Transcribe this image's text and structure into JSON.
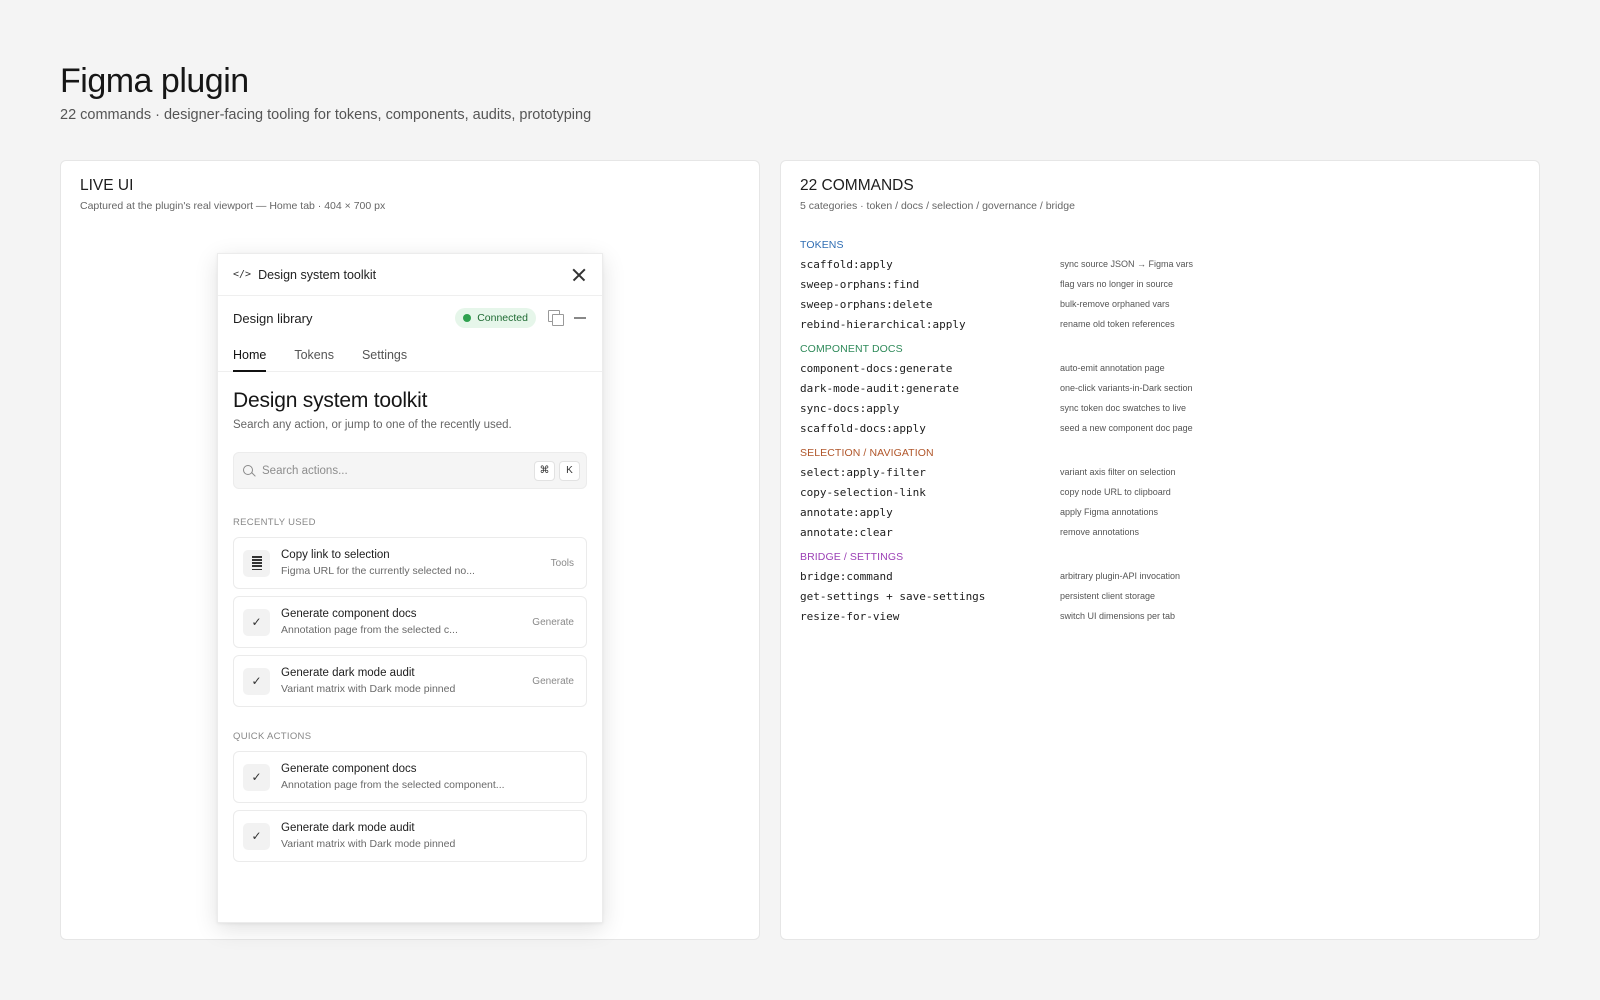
{
  "page": {
    "title": "Figma plugin",
    "subtitle": "22 commands · designer-facing tooling for tokens, components, audits, prototyping"
  },
  "live_ui": {
    "title": "LIVE UI",
    "subtitle": "Captured at the plugin's real viewport — Home tab · 404 × 700 px"
  },
  "plugin": {
    "code_icon": "</>",
    "name": "Design system toolkit",
    "library": "Design library",
    "status": "Connected",
    "tabs": [
      {
        "label": "Home",
        "active": true
      },
      {
        "label": "Tokens",
        "active": false
      },
      {
        "label": "Settings",
        "active": false
      }
    ],
    "hero_title": "Design system toolkit",
    "hero_subtitle": "Search any action, or jump to one of the recently used.",
    "search": {
      "placeholder": "Search actions...",
      "kbd_1": "⌘",
      "kbd_2": "K"
    },
    "recent_label": "RECENTLY USED",
    "recent": [
      {
        "icon": "document-icon",
        "title": "Copy link to selection",
        "desc": "Figma URL for the currently selected no...",
        "tag": "Tools"
      },
      {
        "icon": "check-icon",
        "title": "Generate component docs",
        "desc": "Annotation page from the selected c...",
        "tag": "Generate"
      },
      {
        "icon": "check-icon",
        "title": "Generate dark mode audit",
        "desc": "Variant matrix with Dark mode pinned",
        "tag": "Generate"
      }
    ],
    "quick_label": "QUICK ACTIONS",
    "quick": [
      {
        "icon": "check-icon",
        "title": "Generate component docs",
        "desc": "Annotation page from the selected component..."
      },
      {
        "icon": "check-icon",
        "title": "Generate dark mode audit",
        "desc": "Variant matrix with Dark mode pinned"
      }
    ],
    "check_glyph": "✓"
  },
  "commands": {
    "title": "22 COMMANDS",
    "subtitle": "5 categories · token / docs / selection / governance / bridge",
    "categories": [
      {
        "label": "TOKENS",
        "color": "#2f6db3",
        "items": [
          {
            "name": "scaffold:apply",
            "desc": "sync source JSON → Figma vars"
          },
          {
            "name": "sweep-orphans:find",
            "desc": "flag vars no longer in source"
          },
          {
            "name": "sweep-orphans:delete",
            "desc": "bulk-remove orphaned vars"
          },
          {
            "name": "rebind-hierarchical:apply",
            "desc": "rename old token references"
          }
        ]
      },
      {
        "label": "COMPONENT DOCS",
        "color": "#2f8a5a",
        "items": [
          {
            "name": "component-docs:generate",
            "desc": "auto-emit annotation page"
          },
          {
            "name": "dark-mode-audit:generate",
            "desc": "one-click variants-in-Dark section"
          },
          {
            "name": "sync-docs:apply",
            "desc": "sync token doc swatches to live"
          },
          {
            "name": "scaffold-docs:apply",
            "desc": "seed a new component doc page"
          }
        ]
      },
      {
        "label": "SELECTION / NAVIGATION",
        "color": "#b0562a",
        "items": [
          {
            "name": "select:apply-filter",
            "desc": "variant axis filter on selection"
          },
          {
            "name": "copy-selection-link",
            "desc": "copy node URL to clipboard"
          },
          {
            "name": "annotate:apply",
            "desc": "apply Figma annotations"
          },
          {
            "name": "annotate:clear",
            "desc": "remove annotations"
          }
        ]
      },
      {
        "label": "BRIDGE / SETTINGS",
        "color": "#9b3fb5",
        "items": [
          {
            "name": "bridge:command",
            "desc": "arbitrary plugin-API invocation"
          },
          {
            "name": "get-settings + save-settings",
            "desc": "persistent client storage"
          },
          {
            "name": "resize-for-view",
            "desc": "switch UI dimensions per tab"
          }
        ]
      }
    ]
  }
}
